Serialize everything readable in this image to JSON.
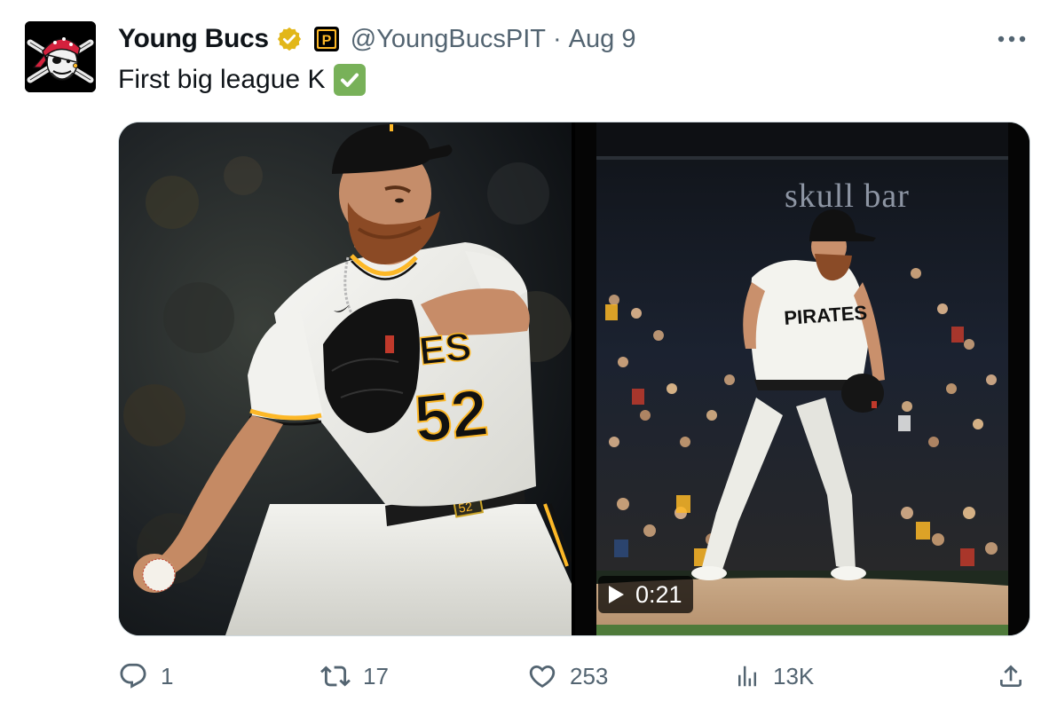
{
  "author": {
    "display_name": "Young Bucs",
    "handle": "@YoungBucsPIT",
    "separator": "·",
    "date": "Aug 9",
    "affiliate_badge_letter": "P"
  },
  "tweet": {
    "text": "First big league K"
  },
  "media": {
    "video_duration": "0:21",
    "photo": {
      "jersey_text": "ES",
      "jersey_number": "52",
      "belt_number": "52"
    },
    "video": {
      "scoreboard_text": "skull bar",
      "jersey_text": "PIRATES"
    }
  },
  "actions": {
    "replies": "1",
    "reposts": "17",
    "likes": "253",
    "views": "13K"
  },
  "icons": {
    "more": "more-horizontal-icon",
    "reply": "reply-icon",
    "repost": "repost-icon",
    "like": "heart-icon",
    "views": "views-icon",
    "share": "share-icon"
  },
  "colors": {
    "text_primary": "#0f1419",
    "text_secondary": "#536471",
    "verified_gold": "#e2b719",
    "pirates_gold": "#fdb827",
    "pirates_black": "#27251f",
    "border": "#cfd9de",
    "check_green": "#78b159"
  }
}
